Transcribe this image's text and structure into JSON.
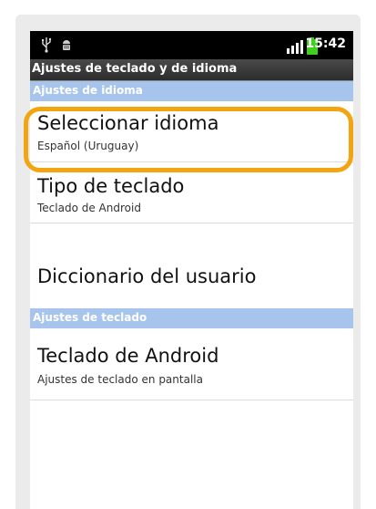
{
  "status_bar": {
    "time": "15:42",
    "icons": [
      "usb-icon",
      "android-debug-icon",
      "signal-icon",
      "battery-icon"
    ],
    "battery_color": "#3fcf1f"
  },
  "title_bar": {
    "title": "Ajustes de teclado y de idioma"
  },
  "sections": [
    {
      "header": "Ajustes de idioma",
      "items": [
        {
          "title": "Seleccionar idioma",
          "subtitle": "Español (Uruguay)",
          "highlighted": true
        },
        {
          "title": "Tipo de teclado",
          "subtitle": "Teclado de Android"
        },
        {
          "title": "Diccionario del usuario",
          "subtitle": ""
        }
      ]
    },
    {
      "header": "Ajustes de teclado",
      "items": [
        {
          "title": "Teclado de Android",
          "subtitle": "Ajustes de teclado en pantalla"
        }
      ]
    }
  ],
  "colors": {
    "section_header_bg": "#a6c4ec",
    "highlight": "#f2a511",
    "frame_bg": "#ebebeb"
  }
}
